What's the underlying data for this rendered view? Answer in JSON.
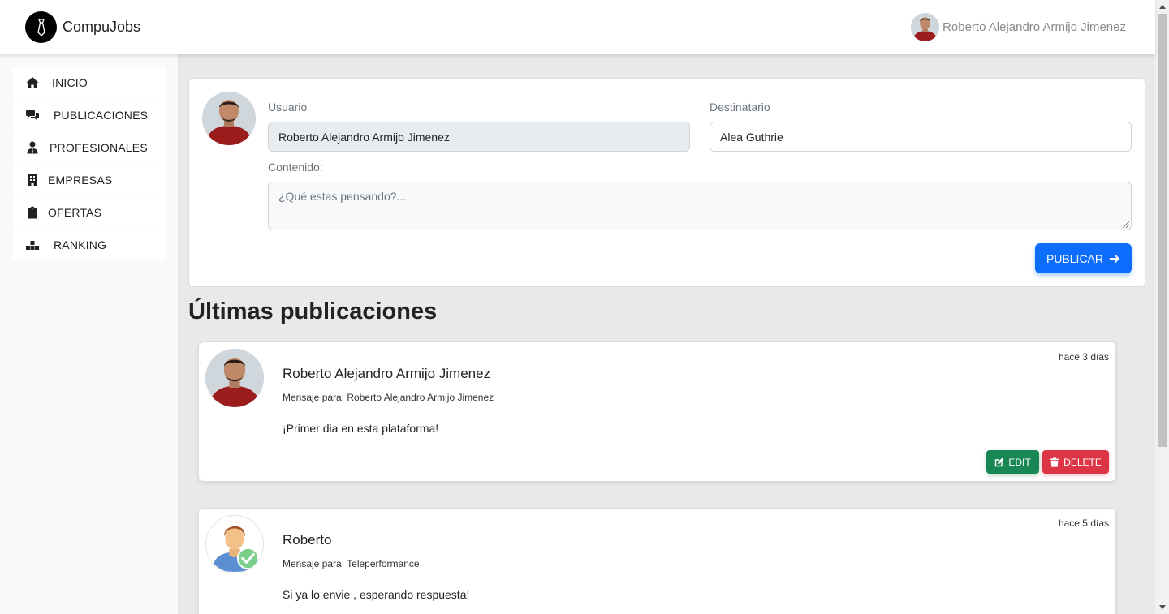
{
  "header": {
    "brand": "CompuJobs",
    "user_name": "Roberto Alejandro Armijo Jimenez"
  },
  "sidebar": {
    "items": [
      {
        "label": "INICIO",
        "icon": "home-icon"
      },
      {
        "label": "PUBLICACIONES",
        "icon": "comments-icon"
      },
      {
        "label": "PROFESIONALES",
        "icon": "user-tie-icon"
      },
      {
        "label": "EMPRESAS",
        "icon": "building-icon"
      },
      {
        "label": "OFERTAS",
        "icon": "clipboard-icon"
      },
      {
        "label": "RANKING",
        "icon": "ranking-icon"
      }
    ]
  },
  "compose": {
    "usuario_label": "Usuario",
    "usuario_value": "Roberto Alejandro Armijo Jimenez",
    "destinatario_label": "Destinatario",
    "destinatario_value": "Alea Guthrie",
    "contenido_label": "Contenido:",
    "contenido_placeholder": "¿Qué estas pensando?...",
    "publish_label": "PUBLICAR"
  },
  "feed": {
    "title": "Últimas publicaciones",
    "posts": [
      {
        "author": "Roberto Alejandro Armijo Jimenez",
        "recipient": "Mensaje para: Roberto Alejandro Armijo Jimenez",
        "time": "hace 3 días",
        "text": "¡Primer dia en esta plataforma!",
        "edit_label": "EDIT",
        "delete_label": "DELETE"
      },
      {
        "author": "Roberto",
        "recipient": "Mensaje para: Teleperformance",
        "time": "hace 5 días",
        "text": "Si ya lo envie , esperando respuesta!"
      }
    ]
  },
  "colors": {
    "primary": "#0d6efd",
    "success": "#198754",
    "danger": "#dc3545",
    "background": "#e9e9e9"
  }
}
